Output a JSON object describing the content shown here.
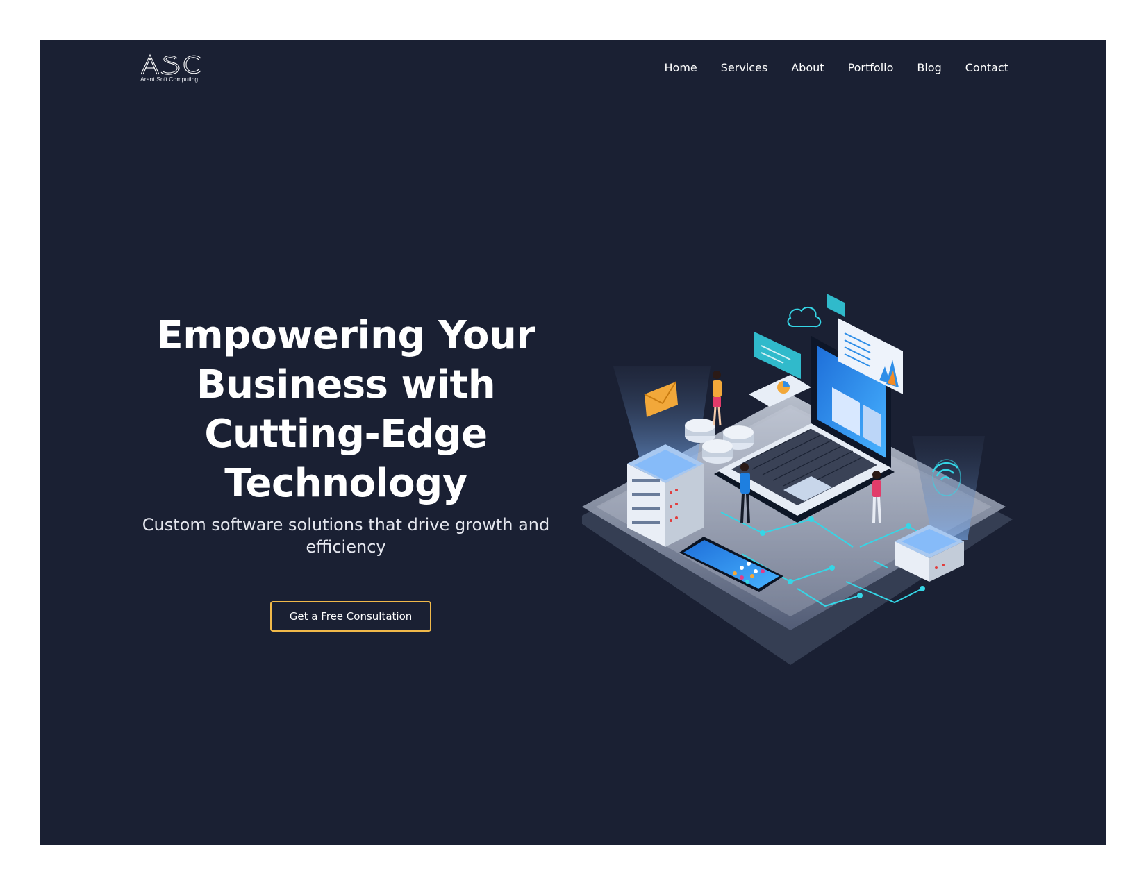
{
  "header": {
    "logo": {
      "mark": "ASC",
      "subtitle": "Arant Soft Computing"
    },
    "nav": [
      {
        "label": "Home"
      },
      {
        "label": "Services"
      },
      {
        "label": "About"
      },
      {
        "label": "Portfolio"
      },
      {
        "label": "Blog"
      },
      {
        "label": "Contact"
      }
    ]
  },
  "hero": {
    "title": "Empowering Your Business with Cutting-Edge Technology",
    "subtitle": "Custom software solutions that drive growth and efficiency",
    "cta_label": "Get a Free Consultation"
  },
  "colors": {
    "background": "#1a2033",
    "page": "#ffffff",
    "cta_border": "#f0b94a",
    "accent_cyan": "#35d6e6",
    "accent_blue": "#2e8ee8"
  }
}
